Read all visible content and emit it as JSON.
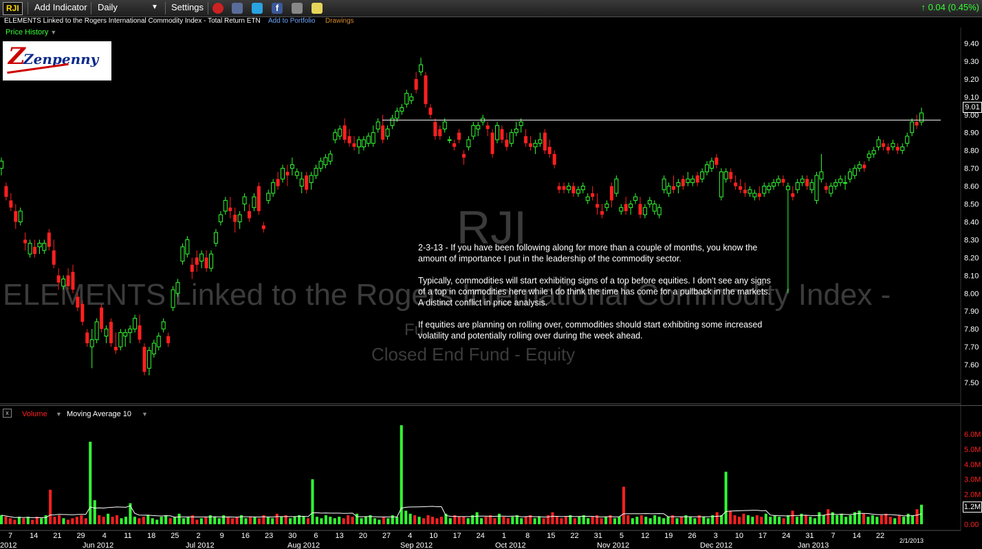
{
  "toolbar": {
    "symbol": "RJI",
    "add_indicator": "Add Indicator",
    "interval": "Daily",
    "settings": "Settings",
    "change": "0.04 (0.45%)",
    "colors": {
      "up": "#33ff33",
      "down": "#ff2020"
    }
  },
  "info": {
    "name": "ELEMENTS Linked to the Rogers International Commodity Index - Total Return ETN",
    "add_portfolio": "Add to Portfolio",
    "drawings": "Drawings"
  },
  "price_panel": {
    "label": "Price History",
    "logo_text": "Zenpenny",
    "last_price": "9.01"
  },
  "watermark": {
    "symbol": "RJI",
    "name": "ELEMENTS Linked to the Rogers International Commodity Index -",
    "sub": "Fu",
    "type": "Closed End Fund - Equity"
  },
  "note": {
    "p1": "2-3-13 - If you have been following along for more than a couple of months, you know the amount of importance I put in the leadership of the commodity sector.",
    "p2": "Typically, commodities will start exhibiting signs of a top before equities. I don't see any signs of a top in commodities here while I do think the time has come for a pullback in the markets. A distinct conflict in price analysis.",
    "p3": "If equities are planning on rolling over, commodities should start exhibiting some increased volatility and potentially rolling over during the week ahead."
  },
  "volume_panel": {
    "label": "Volume",
    "ma_label": "Moving Average 10",
    "last_volume": "1.2M"
  },
  "chart_data": {
    "type": "candlestick",
    "price_axis": {
      "min": 7.5,
      "max": 9.4,
      "ticks": [
        "9.40",
        "9.30",
        "9.20",
        "9.10",
        "9.00",
        "8.90",
        "8.80",
        "8.70",
        "8.60",
        "8.50",
        "8.40",
        "8.30",
        "8.20",
        "8.10",
        "8.00",
        "7.90",
        "7.80",
        "7.70",
        "7.60",
        "7.50"
      ]
    },
    "volume_axis": {
      "min": 0,
      "max": 6.5,
      "unit": "M",
      "ticks": [
        "6.0M",
        "5.0M",
        "4.0M",
        "3.0M",
        "2.0M",
        "1.0M",
        "0.00"
      ]
    },
    "resistance_level": 8.97,
    "x_tick_labels": [
      "7",
      "14",
      "21",
      "29",
      "4",
      "11",
      "18",
      "25",
      "2",
      "9",
      "16",
      "23",
      "30",
      "6",
      "13",
      "20",
      "27",
      "4",
      "10",
      "17",
      "24",
      "1",
      "8",
      "15",
      "22",
      "31",
      "5",
      "12",
      "19",
      "26",
      "3",
      "10",
      "17",
      "24",
      "31",
      "7",
      "14",
      "22"
    ],
    "month_labels": [
      "2012",
      "Jun 2012",
      "Jul 2012",
      "Aug 2012",
      "Sep 2012",
      "Oct 2012",
      "Nov 2012",
      "Dec 2012",
      "Jan 2013"
    ],
    "last_date": "2/1/2013",
    "candles": [
      [
        8.7,
        8.76,
        8.66,
        8.74
      ],
      [
        8.6,
        8.62,
        8.52,
        8.54
      ],
      [
        8.52,
        8.56,
        8.46,
        8.48
      ],
      [
        8.46,
        8.5,
        8.36,
        8.4
      ],
      [
        8.4,
        8.48,
        8.38,
        8.46
      ],
      [
        8.3,
        8.34,
        8.24,
        8.28
      ],
      [
        8.22,
        8.3,
        8.2,
        8.28
      ],
      [
        8.26,
        8.3,
        8.2,
        8.22
      ],
      [
        8.26,
        8.3,
        8.22,
        8.28
      ],
      [
        8.24,
        8.3,
        8.22,
        8.28
      ],
      [
        8.34,
        8.36,
        8.24,
        8.26
      ],
      [
        8.24,
        8.3,
        8.14,
        8.16
      ],
      [
        8.1,
        8.14,
        8.02,
        8.06
      ],
      [
        8.04,
        8.1,
        8.02,
        8.08
      ],
      [
        8.1,
        8.14,
        8.02,
        8.04
      ],
      [
        8.12,
        8.16,
        8.0,
        8.02
      ],
      [
        7.98,
        8.0,
        7.9,
        7.92
      ],
      [
        7.94,
        7.96,
        7.82,
        7.84
      ],
      [
        7.78,
        7.8,
        7.7,
        7.72
      ],
      [
        7.7,
        7.8,
        7.58,
        7.74
      ],
      [
        7.74,
        7.86,
        7.72,
        7.84
      ],
      [
        7.92,
        7.94,
        7.78,
        7.8
      ],
      [
        7.76,
        7.82,
        7.72,
        7.8
      ],
      [
        7.84,
        7.86,
        7.7,
        7.72
      ],
      [
        7.7,
        7.78,
        7.66,
        7.68
      ],
      [
        7.7,
        7.8,
        7.68,
        7.78
      ],
      [
        7.76,
        7.8,
        7.7,
        7.78
      ],
      [
        7.78,
        7.82,
        7.72,
        7.8
      ],
      [
        7.8,
        7.88,
        7.78,
        7.86
      ],
      [
        7.82,
        7.88,
        7.72,
        7.74
      ],
      [
        7.7,
        7.72,
        7.54,
        7.56
      ],
      [
        7.58,
        7.7,
        7.54,
        7.68
      ],
      [
        7.66,
        7.74,
        7.64,
        7.72
      ],
      [
        7.7,
        7.78,
        7.68,
        7.76
      ],
      [
        7.8,
        7.86,
        7.78,
        7.84
      ],
      [
        7.76,
        7.78,
        7.7,
        7.72
      ],
      [
        7.92,
        8.04,
        7.9,
        8.02
      ],
      [
        8.0,
        8.08,
        7.98,
        8.06
      ],
      [
        8.18,
        8.28,
        8.16,
        8.26
      ],
      [
        8.22,
        8.32,
        8.2,
        8.3
      ],
      [
        8.16,
        8.2,
        8.08,
        8.12
      ],
      [
        8.2,
        8.24,
        8.12,
        8.16
      ],
      [
        8.18,
        8.24,
        8.14,
        8.22
      ],
      [
        8.2,
        8.24,
        8.12,
        8.14
      ],
      [
        8.14,
        8.24,
        8.12,
        8.22
      ],
      [
        8.28,
        8.36,
        8.26,
        8.34
      ],
      [
        8.4,
        8.46,
        8.38,
        8.44
      ],
      [
        8.46,
        8.54,
        8.44,
        8.52
      ],
      [
        8.48,
        8.54,
        8.42,
        8.46
      ],
      [
        8.44,
        8.48,
        8.34,
        8.4
      ],
      [
        8.4,
        8.46,
        8.36,
        8.44
      ],
      [
        8.5,
        8.56,
        8.46,
        8.54
      ],
      [
        8.46,
        8.5,
        8.4,
        8.42
      ],
      [
        8.48,
        8.56,
        8.46,
        8.54
      ],
      [
        8.6,
        8.62,
        8.44,
        8.46
      ],
      [
        8.38,
        8.4,
        8.34,
        8.36
      ],
      [
        8.52,
        8.58,
        8.5,
        8.56
      ],
      [
        8.56,
        8.64,
        8.54,
        8.62
      ],
      [
        8.64,
        8.68,
        8.58,
        8.6
      ],
      [
        8.64,
        8.72,
        8.62,
        8.7
      ],
      [
        8.68,
        8.72,
        8.6,
        8.66
      ],
      [
        8.7,
        8.76,
        8.66,
        8.72
      ],
      [
        8.66,
        8.7,
        8.64,
        8.68
      ],
      [
        8.6,
        8.68,
        8.56,
        8.64
      ],
      [
        8.66,
        8.68,
        8.56,
        8.58
      ],
      [
        8.62,
        8.68,
        8.58,
        8.66
      ],
      [
        8.66,
        8.72,
        8.64,
        8.7
      ],
      [
        8.7,
        8.76,
        8.68,
        8.74
      ],
      [
        8.72,
        8.78,
        8.7,
        8.76
      ],
      [
        8.74,
        8.8,
        8.72,
        8.78
      ],
      [
        8.86,
        8.92,
        8.84,
        8.9
      ],
      [
        8.88,
        8.94,
        8.86,
        8.92
      ],
      [
        8.94,
        8.98,
        8.84,
        8.86
      ],
      [
        8.88,
        8.92,
        8.82,
        8.84
      ],
      [
        8.84,
        8.88,
        8.8,
        8.82
      ],
      [
        8.82,
        8.88,
        8.78,
        8.86
      ],
      [
        8.82,
        8.88,
        8.8,
        8.86
      ],
      [
        8.84,
        8.9,
        8.82,
        8.88
      ],
      [
        8.84,
        8.94,
        8.82,
        8.9
      ],
      [
        8.92,
        8.98,
        8.9,
        8.96
      ],
      [
        8.94,
        9.0,
        8.84,
        8.86
      ],
      [
        8.88,
        8.94,
        8.86,
        8.92
      ],
      [
        8.94,
        9.0,
        8.92,
        8.98
      ],
      [
        8.98,
        9.04,
        8.96,
        9.02
      ],
      [
        9.02,
        9.06,
        9.0,
        9.04
      ],
      [
        9.06,
        9.14,
        9.04,
        9.12
      ],
      [
        9.08,
        9.12,
        9.06,
        9.1
      ],
      [
        9.2,
        9.24,
        9.12,
        9.14
      ],
      [
        9.24,
        9.32,
        9.22,
        9.28
      ],
      [
        9.22,
        9.24,
        9.04,
        9.06
      ],
      [
        9.04,
        9.06,
        8.98,
        9.0
      ],
      [
        8.96,
        8.98,
        8.86,
        8.88
      ],
      [
        8.92,
        8.94,
        8.86,
        8.88
      ],
      [
        8.92,
        8.98,
        8.9,
        8.96
      ],
      [
        8.86,
        8.88,
        8.84,
        8.86
      ],
      [
        8.84,
        8.86,
        8.8,
        8.82
      ],
      [
        8.9,
        8.92,
        8.84,
        8.86
      ],
      [
        8.78,
        8.8,
        8.72,
        8.76
      ],
      [
        8.82,
        8.88,
        8.8,
        8.86
      ],
      [
        8.88,
        8.96,
        8.86,
        8.94
      ],
      [
        8.92,
        8.96,
        8.88,
        8.94
      ],
      [
        8.96,
        9.0,
        8.94,
        8.98
      ],
      [
        8.94,
        8.96,
        8.88,
        8.92
      ],
      [
        8.9,
        8.92,
        8.76,
        8.78
      ],
      [
        8.86,
        8.96,
        8.84,
        8.94
      ],
      [
        8.92,
        8.94,
        8.84,
        8.86
      ],
      [
        8.86,
        8.9,
        8.8,
        8.82
      ],
      [
        8.84,
        8.92,
        8.82,
        8.9
      ],
      [
        8.9,
        8.96,
        8.88,
        8.92
      ],
      [
        8.94,
        8.98,
        8.9,
        8.96
      ],
      [
        8.88,
        8.92,
        8.82,
        8.84
      ],
      [
        8.84,
        8.88,
        8.8,
        8.82
      ],
      [
        8.82,
        8.86,
        8.78,
        8.84
      ],
      [
        8.84,
        8.9,
        8.82,
        8.86
      ],
      [
        8.9,
        8.92,
        8.78,
        8.8
      ],
      [
        8.82,
        8.86,
        8.76,
        8.78
      ],
      [
        8.78,
        8.8,
        8.7,
        8.72
      ],
      [
        8.6,
        8.62,
        8.56,
        8.58
      ],
      [
        8.6,
        8.62,
        8.56,
        8.58
      ],
      [
        8.58,
        8.62,
        8.56,
        8.6
      ],
      [
        8.6,
        8.62,
        8.54,
        8.56
      ],
      [
        8.56,
        8.6,
        8.54,
        8.58
      ],
      [
        8.58,
        8.62,
        8.56,
        8.6
      ],
      [
        8.52,
        8.56,
        8.5,
        8.54
      ],
      [
        8.56,
        8.6,
        8.52,
        8.54
      ],
      [
        8.5,
        8.56,
        8.44,
        8.48
      ],
      [
        8.46,
        8.5,
        8.42,
        8.44
      ],
      [
        8.48,
        8.52,
        8.46,
        8.5
      ],
      [
        8.6,
        8.62,
        8.48,
        8.52
      ],
      [
        8.56,
        8.66,
        8.54,
        8.64
      ],
      [
        8.46,
        8.5,
        8.44,
        8.48
      ],
      [
        8.5,
        8.54,
        8.44,
        8.46
      ],
      [
        8.48,
        8.52,
        8.44,
        8.5
      ],
      [
        8.52,
        8.56,
        8.5,
        8.54
      ],
      [
        8.5,
        8.54,
        8.42,
        8.44
      ],
      [
        8.44,
        8.5,
        8.42,
        8.48
      ],
      [
        8.5,
        8.54,
        8.48,
        8.52
      ],
      [
        8.46,
        8.52,
        8.44,
        8.5
      ],
      [
        8.44,
        8.5,
        8.42,
        8.48
      ],
      [
        8.58,
        8.66,
        8.56,
        8.64
      ],
      [
        8.56,
        8.62,
        8.54,
        8.6
      ],
      [
        8.6,
        8.66,
        8.56,
        8.58
      ],
      [
        8.6,
        8.64,
        8.56,
        8.62
      ],
      [
        8.64,
        8.66,
        8.58,
        8.6
      ],
      [
        8.62,
        8.68,
        8.6,
        8.64
      ],
      [
        8.62,
        8.66,
        8.6,
        8.64
      ],
      [
        8.66,
        8.68,
        8.6,
        8.62
      ],
      [
        8.64,
        8.7,
        8.62,
        8.68
      ],
      [
        8.68,
        8.74,
        8.66,
        8.72
      ],
      [
        8.7,
        8.76,
        8.68,
        8.74
      ],
      [
        8.76,
        8.78,
        8.7,
        8.72
      ],
      [
        8.54,
        8.7,
        8.52,
        8.68
      ],
      [
        8.64,
        8.7,
        8.62,
        8.68
      ],
      [
        8.68,
        8.7,
        8.62,
        8.64
      ],
      [
        8.62,
        8.66,
        8.58,
        8.6
      ],
      [
        8.6,
        8.64,
        8.56,
        8.58
      ],
      [
        8.58,
        8.62,
        8.54,
        8.56
      ],
      [
        8.56,
        8.6,
        8.54,
        8.58
      ],
      [
        8.54,
        8.58,
        8.52,
        8.56
      ],
      [
        8.56,
        8.6,
        8.52,
        8.54
      ],
      [
        8.56,
        8.62,
        8.54,
        8.6
      ],
      [
        8.58,
        8.62,
        8.56,
        8.6
      ],
      [
        8.6,
        8.64,
        8.58,
        8.62
      ],
      [
        8.62,
        8.66,
        8.6,
        8.64
      ],
      [
        8.64,
        8.66,
        8.6,
        8.62
      ],
      [
        8.58,
        8.62,
        8.0,
        8.6
      ],
      [
        8.56,
        8.6,
        8.52,
        8.54
      ],
      [
        8.58,
        8.64,
        8.56,
        8.62
      ],
      [
        8.62,
        8.66,
        8.6,
        8.64
      ],
      [
        8.64,
        8.66,
        8.58,
        8.6
      ],
      [
        8.58,
        8.64,
        8.56,
        8.62
      ],
      [
        8.52,
        8.68,
        8.5,
        8.66
      ],
      [
        8.64,
        8.78,
        8.62,
        8.68
      ],
      [
        8.6,
        8.62,
        8.56,
        8.58
      ],
      [
        8.56,
        8.62,
        8.54,
        8.6
      ],
      [
        8.6,
        8.64,
        8.58,
        8.62
      ],
      [
        8.62,
        8.66,
        8.6,
        8.64
      ],
      [
        8.62,
        8.66,
        8.58,
        8.62
      ],
      [
        8.64,
        8.7,
        8.62,
        8.68
      ],
      [
        8.66,
        8.72,
        8.64,
        8.7
      ],
      [
        8.7,
        8.74,
        8.68,
        8.72
      ],
      [
        8.72,
        8.74,
        8.68,
        8.7
      ],
      [
        8.76,
        8.8,
        8.74,
        8.78
      ],
      [
        8.78,
        8.82,
        8.76,
        8.8
      ],
      [
        8.82,
        8.88,
        8.8,
        8.86
      ],
      [
        8.84,
        8.86,
        8.8,
        8.82
      ],
      [
        8.82,
        8.84,
        8.78,
        8.8
      ],
      [
        8.82,
        8.86,
        8.8,
        8.84
      ],
      [
        8.82,
        8.84,
        8.78,
        8.8
      ],
      [
        8.8,
        8.84,
        8.78,
        8.82
      ],
      [
        8.84,
        8.9,
        8.82,
        8.88
      ],
      [
        8.9,
        8.98,
        8.88,
        8.96
      ],
      [
        8.96,
        9.0,
        8.92,
        8.94
      ],
      [
        8.96,
        9.04,
        8.94,
        9.01
      ]
    ],
    "volumes_m": [
      0.6,
      0.5,
      0.4,
      0.3,
      0.5,
      0.4,
      0.5,
      0.3,
      0.5,
      0.4,
      0.6,
      2.3,
      0.5,
      0.6,
      0.4,
      0.3,
      0.4,
      0.5,
      0.6,
      0.4,
      5.5,
      1.6,
      0.6,
      0.5,
      0.7,
      0.5,
      0.6,
      0.4,
      0.5,
      1.4,
      0.5,
      0.4,
      0.5,
      0.6,
      0.4,
      0.3,
      0.5,
      0.6,
      0.4,
      0.5,
      0.7,
      0.4,
      0.5,
      0.6,
      0.3,
      0.4,
      0.5,
      0.6,
      0.5,
      0.4,
      0.6,
      0.5,
      0.4,
      0.5,
      0.6,
      0.4,
      0.5,
      0.5,
      0.4,
      0.6,
      0.5,
      0.4,
      0.7,
      0.5,
      0.6,
      0.4,
      0.5,
      0.6,
      0.5,
      0.4,
      3.0,
      0.5,
      0.4,
      0.6,
      0.5,
      0.4,
      0.5,
      0.4,
      0.6,
      0.5,
      0.7,
      0.4,
      0.5,
      0.6,
      0.4,
      0.3,
      0.5,
      0.4,
      0.6,
      0.5,
      6.6,
      0.9,
      0.7,
      0.6,
      0.5,
      0.4,
      0.6,
      0.5,
      0.4,
      0.5,
      0.7,
      0.4,
      0.6,
      0.5,
      0.5,
      0.4,
      0.6,
      0.8,
      0.4,
      0.5,
      0.6,
      0.4,
      0.7,
      0.5,
      0.4,
      0.5,
      0.6,
      0.4,
      0.5,
      0.6,
      0.4,
      0.5,
      0.4,
      0.6,
      0.8,
      0.5,
      0.4,
      0.5,
      0.6,
      0.4,
      0.5,
      0.6,
      0.4,
      0.5,
      0.6,
      0.4,
      0.5,
      0.6,
      0.4,
      0.5,
      2.5,
      0.6,
      0.4,
      0.5,
      0.6,
      0.5,
      0.4,
      0.6,
      0.5,
      0.4,
      0.5,
      0.6,
      0.4,
      0.5,
      0.6,
      0.5,
      0.4,
      0.6,
      0.5,
      0.4,
      0.6,
      0.8,
      0.6,
      3.5,
      0.9,
      0.6,
      0.5,
      0.7,
      0.6,
      0.5,
      0.6,
      0.5,
      0.7,
      0.5,
      0.6,
      0.5,
      0.4,
      0.6,
      0.9,
      0.5,
      0.7,
      0.6,
      0.5,
      0.4,
      0.8,
      0.6,
      1.0,
      0.8,
      0.6,
      0.7,
      0.5,
      0.6,
      0.8,
      0.9,
      0.7,
      0.5,
      0.6,
      0.5,
      0.6,
      0.7,
      0.5,
      0.4,
      0.6,
      0.5,
      0.7,
      0.6,
      1.0,
      1.3
    ]
  }
}
